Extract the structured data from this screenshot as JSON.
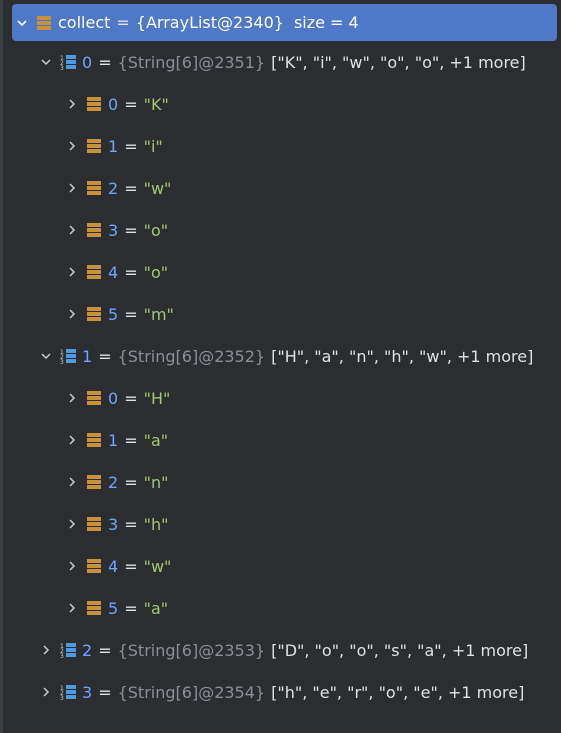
{
  "root": {
    "name": "collect",
    "type": "{ArrayList@2340}",
    "size_text": "size = 4"
  },
  "items": [
    {
      "index": "0",
      "type": "{String[6]@2351}",
      "preview": "[\"K\", \"i\", \"w\", \"o\", \"o\", +1 more]",
      "children": [
        {
          "index": "0",
          "value": "\"K\""
        },
        {
          "index": "1",
          "value": "\"i\""
        },
        {
          "index": "2",
          "value": "\"w\""
        },
        {
          "index": "3",
          "value": "\"o\""
        },
        {
          "index": "4",
          "value": "\"o\""
        },
        {
          "index": "5",
          "value": "\"m\""
        }
      ]
    },
    {
      "index": "1",
      "type": "{String[6]@2352}",
      "preview": "[\"H\", \"a\", \"n\", \"h\", \"w\", +1 more]",
      "children": [
        {
          "index": "0",
          "value": "\"H\""
        },
        {
          "index": "1",
          "value": "\"a\""
        },
        {
          "index": "2",
          "value": "\"n\""
        },
        {
          "index": "3",
          "value": "\"h\""
        },
        {
          "index": "4",
          "value": "\"w\""
        },
        {
          "index": "5",
          "value": "\"a\""
        }
      ]
    },
    {
      "index": "2",
      "type": "{String[6]@2353}",
      "preview": "[\"D\", \"o\", \"o\", \"s\", \"a\", +1 more]"
    },
    {
      "index": "3",
      "type": "{String[6]@2354}",
      "preview": "[\"h\", \"e\", \"r\", \"o\", \"e\", +1 more]"
    }
  ],
  "colors": {
    "background": "#2b2d30",
    "selection": "#4f78c8",
    "name": "#6ea6ff",
    "string_value": "#a5c76f",
    "type_text": "#8b8f96",
    "field_icon": "#c9913c",
    "array_icon": "#4d9be0"
  },
  "icons": {
    "field": "field-icon",
    "array": "array-icon",
    "expanded": "chevron-down-icon",
    "collapsed": "chevron-right-icon"
  }
}
